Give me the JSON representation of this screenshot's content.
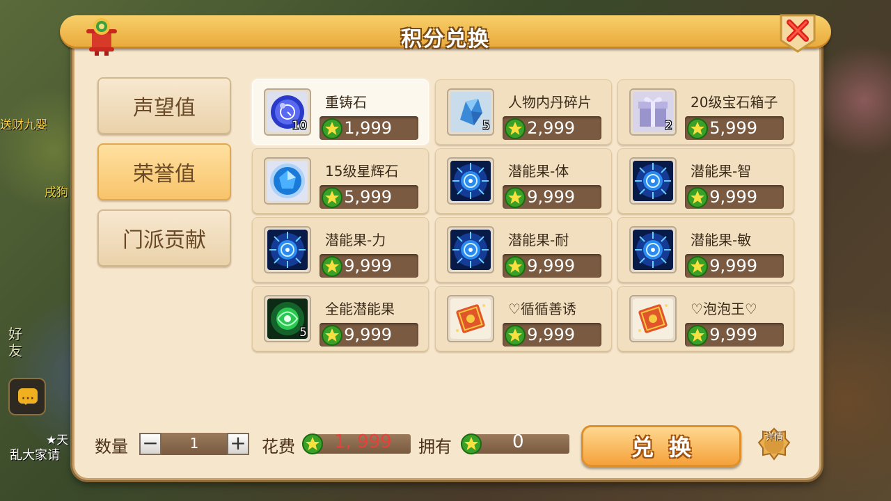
{
  "window": {
    "title": "积分兑换"
  },
  "tabs": [
    {
      "label": "声望值",
      "active": false
    },
    {
      "label": "荣誉值",
      "active": true
    },
    {
      "label": "门派贡献",
      "active": false
    }
  ],
  "items": [
    {
      "name": "重铸石",
      "price": "1,999",
      "count": "10",
      "icon": "blue-orb-icon",
      "selected": true
    },
    {
      "name": "人物内丹碎片",
      "price": "2,999",
      "count": "5",
      "icon": "crystal-shard-icon"
    },
    {
      "name": "20级宝石箱子",
      "price": "5,999",
      "count": "2",
      "icon": "gift-box-icon"
    },
    {
      "name": "15级星辉石",
      "price": "5,999",
      "count": "",
      "icon": "blue-gem-icon"
    },
    {
      "name": "潜能果-体",
      "price": "9,999",
      "count": "",
      "icon": "potential-fruit-icon"
    },
    {
      "name": "潜能果-智",
      "price": "9,999",
      "count": "",
      "icon": "potential-fruit-icon"
    },
    {
      "name": "潜能果-力",
      "price": "9,999",
      "count": "",
      "icon": "potential-fruit-icon"
    },
    {
      "name": "潜能果-耐",
      "price": "9,999",
      "count": "",
      "icon": "potential-fruit-icon"
    },
    {
      "name": "潜能果-敏",
      "price": "9,999",
      "count": "",
      "icon": "potential-fruit-icon"
    },
    {
      "name": "全能潜能果",
      "price": "9,999",
      "count": "5",
      "icon": "green-orb-icon"
    },
    {
      "name": "♡循循善诱",
      "price": "9,999",
      "count": "",
      "icon": "red-ticket-icon"
    },
    {
      "name": "♡泡泡王♡",
      "price": "9,999",
      "count": "",
      "icon": "red-ticket-icon"
    }
  ],
  "footer": {
    "quantity_label": "数量",
    "quantity": "1",
    "minus_label": "−",
    "plus_label": "+",
    "cost_label": "花费",
    "cost_value": "1, 999",
    "own_label": "拥有",
    "own_value": "0",
    "exchange_label": "兑换",
    "detail_label": "详情"
  },
  "background": {
    "fragments": [
      "送财九婴",
      "戌狗",
      "好",
      "友",
      "乱大家请",
      "★天"
    ]
  },
  "colors": {
    "panel_bg": "#f6e6cc",
    "title_bar": "#e8a83a",
    "price_bar": "#7a5a40",
    "cost_text": "#e8403a",
    "active_tab": "#f8c46a"
  }
}
